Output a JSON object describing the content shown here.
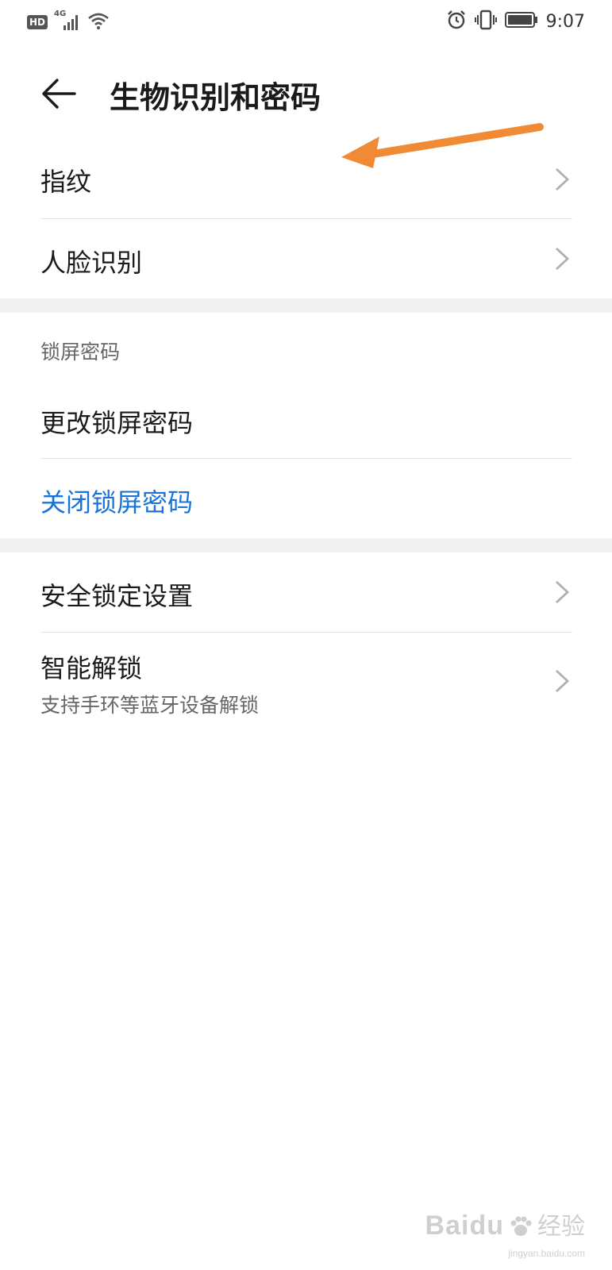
{
  "status_bar": {
    "hd": "HD",
    "network": "4G",
    "time": "9:07"
  },
  "header": {
    "title": "生物识别和密码"
  },
  "biometrics": {
    "items": [
      {
        "label": "指纹"
      },
      {
        "label": "人脸识别"
      }
    ]
  },
  "lock_password": {
    "header": "锁屏密码",
    "change": "更改锁屏密码",
    "close": "关闭锁屏密码"
  },
  "security": {
    "lock_settings": "安全锁定设置",
    "smart_unlock": "智能解锁",
    "smart_unlock_sub": "支持手环等蓝牙设备解锁"
  },
  "colors": {
    "accent_link": "#1a73d6",
    "annotation_arrow": "#f08a35"
  },
  "watermark": {
    "brand": "Baidu",
    "suffix": "经验",
    "url": "jingyan.baidu.com"
  }
}
